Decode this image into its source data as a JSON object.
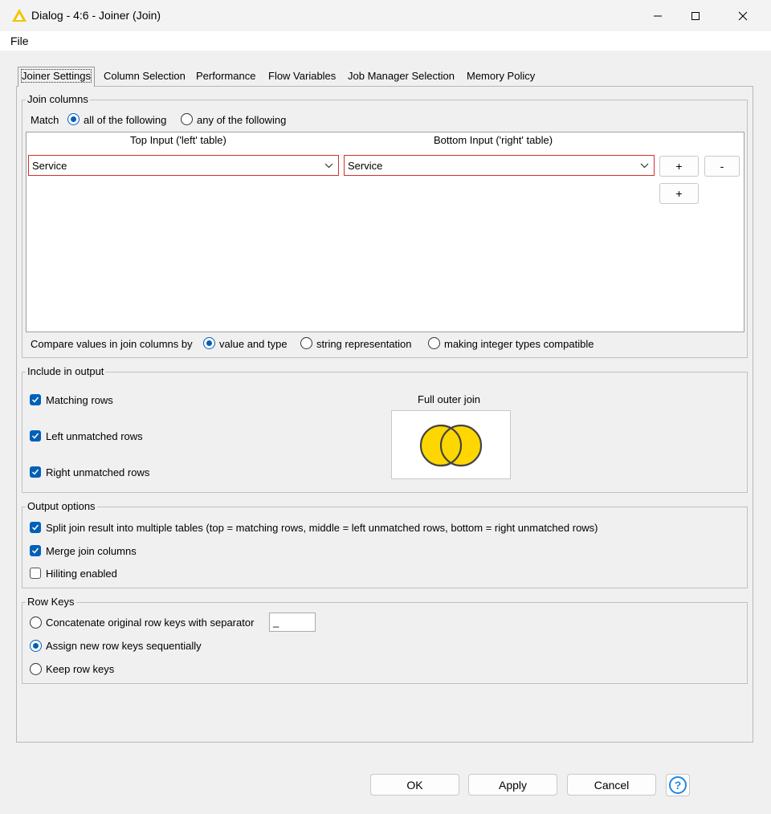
{
  "window": {
    "title": "Dialog - 4:6 - Joiner (Join)"
  },
  "menu": {
    "file_label": "File"
  },
  "tabs": [
    {
      "label": "Joiner Settings",
      "active": true
    },
    {
      "label": "Column Selection"
    },
    {
      "label": "Performance"
    },
    {
      "label": "Flow Variables"
    },
    {
      "label": "Job Manager Selection"
    },
    {
      "label": "Memory Policy"
    }
  ],
  "join_columns": {
    "legend": "Join columns",
    "match_label": "Match",
    "match_all_label": "all of the following",
    "match_any_label": "any of the following",
    "match_selected": "all",
    "top_input_header": "Top Input ('left' table)",
    "bottom_input_header": "Bottom Input ('right' table)",
    "left_column_value": "Service",
    "right_column_value": "Service",
    "add_label": "+",
    "remove_label": "-",
    "compare_label": "Compare values in join columns by",
    "compare_options": [
      "value and type",
      "string representation",
      "making integer types compatible"
    ],
    "compare_selected": "value and type"
  },
  "include_output": {
    "legend": "Include in output",
    "matching_rows": {
      "label": "Matching rows",
      "checked": true
    },
    "left_unmatched": {
      "label": "Left unmatched rows",
      "checked": true
    },
    "right_unmatched": {
      "label": "Right unmatched rows",
      "checked": true
    },
    "join_type_label": "Full outer join"
  },
  "output_options": {
    "legend": "Output options",
    "split": {
      "label": "Split join result into multiple tables (top = matching rows, middle = left unmatched rows, bottom = right unmatched rows)",
      "checked": true
    },
    "merge": {
      "label": "Merge join columns",
      "checked": true
    },
    "hiliting": {
      "label": "Hiliting enabled",
      "checked": false
    }
  },
  "row_keys": {
    "legend": "Row Keys",
    "concatenate_label": "Concatenate original row keys with separator",
    "separator_value": "_",
    "assign_label": "Assign new row keys sequentially",
    "keep_label": "Keep row keys",
    "selected": "assign"
  },
  "buttons": {
    "ok": "OK",
    "apply": "Apply",
    "cancel": "Cancel",
    "help": "?"
  },
  "colors": {
    "accent": "#005fb8",
    "error_border": "#d32f2f",
    "venn_fill": "#ffd700",
    "app_icon": "#f5c400"
  }
}
